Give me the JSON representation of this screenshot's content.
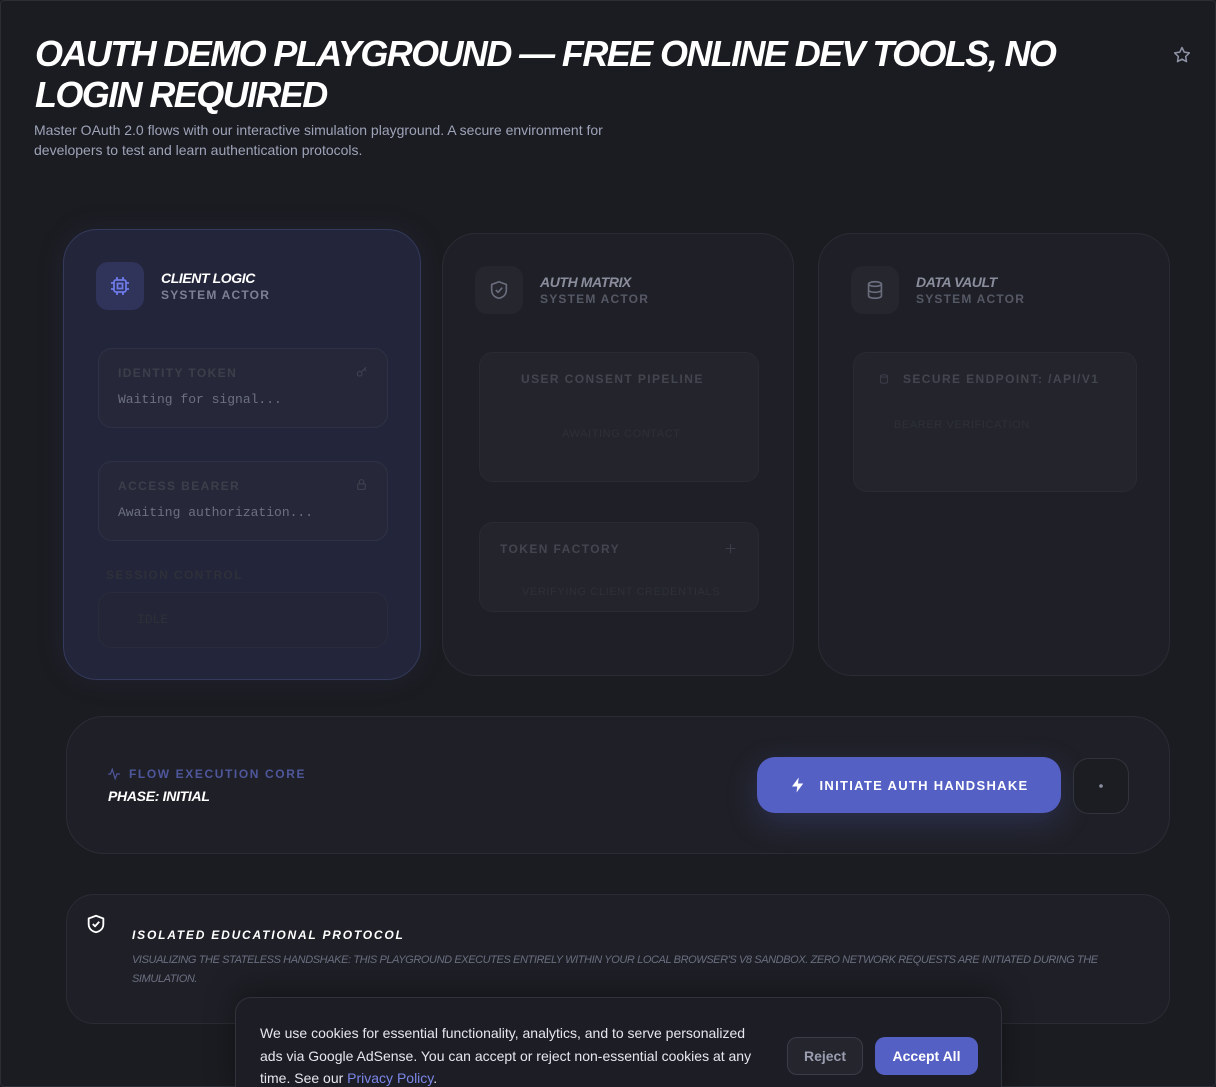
{
  "header": {
    "title": "OAUTH DEMO PLAYGROUND — FREE ONLINE DEV TOOLS, NO LOGIN REQUIRED",
    "subtitle": "Master OAuth 2.0 flows with our interactive simulation playground. A secure environment for developers to test and learn authentication protocols.",
    "favorite_icon": "star-icon"
  },
  "actors": [
    {
      "title": "CLIENT LOGIC",
      "role": "SYSTEM ACTOR",
      "icon": "cpu-chip-icon",
      "active": true,
      "slots": [
        {
          "label": "IDENTITY TOKEN",
          "value": "Waiting for signal...",
          "icon": "key-icon"
        },
        {
          "label": "ACCESS BEARER",
          "value": "Awaiting authorization...",
          "icon": "lock-icon"
        },
        {
          "label": "SESSION CONTROL",
          "value": "IDLE"
        }
      ]
    },
    {
      "title": "AUTH MATRIX",
      "role": "SYSTEM ACTOR",
      "icon": "shield-check-icon",
      "active": false,
      "slots": [
        {
          "label": "USER CONSENT PIPELINE",
          "value": "AWAITING CONTACT"
        },
        {
          "label": "TOKEN FACTORY",
          "value": "VERIFYING CLIENT CREDENTIALS",
          "icon": "sparkle-icon"
        }
      ]
    },
    {
      "title": "DATA VAULT",
      "role": "SYSTEM ACTOR",
      "icon": "database-icon",
      "active": false,
      "slots": [
        {
          "label": "SECURE ENDPOINT: /API/V1",
          "value": "BEARER VERIFICATION",
          "icon": "database-small-icon"
        }
      ]
    }
  ],
  "control": {
    "core_label": "FLOW EXECUTION CORE",
    "phase": "PHASE: INITIAL",
    "initiate_label": "INITIATE AUTH HANDSHAKE",
    "reset_icon": "reset-icon",
    "accent": "#5560c4"
  },
  "notice": {
    "title": "ISOLATED EDUCATIONAL PROTOCOL",
    "text": "VISUALIZING THE STATELESS HANDSHAKE: THIS PLAYGROUND EXECUTES ENTIRELY WITHIN YOUR LOCAL BROWSER'S V8 SANDBOX. ZERO NETWORK REQUESTS ARE INITIATED DURING THE SIMULATION."
  },
  "cookie": {
    "text": "We use cookies for essential functionality, analytics, and to serve personalized ads via Google AdSense. You can accept or reject non-essential cookies at any time. See our ",
    "link": "Privacy Policy",
    "text_end": ".",
    "reject_label": "Reject",
    "accept_label": "Accept All"
  }
}
